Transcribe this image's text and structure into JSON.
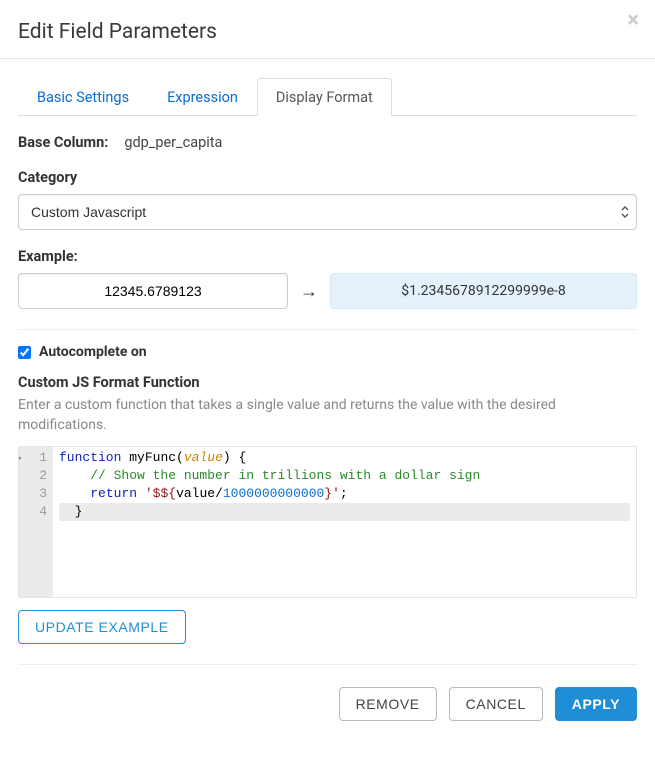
{
  "dialog": {
    "title": "Edit Field Parameters"
  },
  "tabs": [
    {
      "label": "Basic Settings",
      "active": false
    },
    {
      "label": "Expression",
      "active": false
    },
    {
      "label": "Display Format",
      "active": true
    }
  ],
  "base_column": {
    "label": "Base Column:",
    "value": "gdp_per_capita"
  },
  "category": {
    "label": "Category",
    "selected": "Custom Javascript"
  },
  "example": {
    "label": "Example:",
    "input": "12345.6789123",
    "output": "$1.2345678912299999e-8"
  },
  "autocomplete": {
    "label": "Autocomplete on",
    "checked": true
  },
  "custom_fn": {
    "title": "Custom JS Format Function",
    "help": "Enter a custom function that takes a single value and returns the value with the desired modifications."
  },
  "code": {
    "lines": [
      "1",
      "2",
      "3",
      "4"
    ],
    "kw_function": "function",
    "fn_name": "myFunc",
    "arg": "value",
    "comment": "// Show the number in trillions with a dollar sign",
    "kw_return": "return",
    "string_open": "'$${",
    "num_divisor": "1000000000000",
    "deref": "value/",
    "string_close": "}'",
    "semi": ";",
    "paren_open": "(",
    "paren_close": ")",
    "brace_open": " {",
    "brace_close": "}"
  },
  "buttons": {
    "update_example": "UPDATE EXAMPLE",
    "remove": "REMOVE",
    "cancel": "CANCEL",
    "apply": "APPLY"
  }
}
